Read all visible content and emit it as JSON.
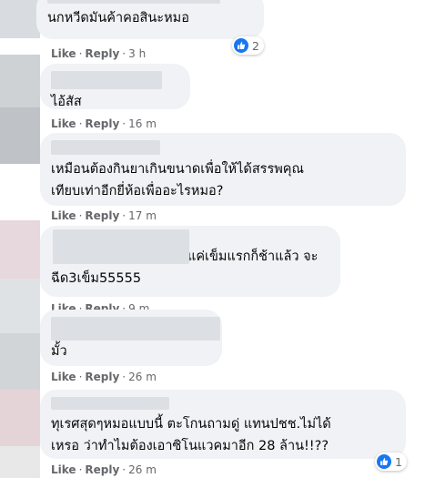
{
  "colors": {
    "bubble_bg": "#f0f2f5",
    "meta_text": "#65676b",
    "like_blue": "#1877f2"
  },
  "icons": {
    "like": "thumbs-up-icon"
  },
  "comments": [
    {
      "text_lines": [
        "นกหวีดมันค้าคอสินะหมอ"
      ],
      "actions": {
        "like": "Like",
        "reply": "Reply",
        "time": "3 h"
      },
      "reaction_count": "2"
    },
    {
      "text_lines": [
        "ไอ้สัส"
      ],
      "actions": {
        "like": "Like",
        "reply": "Reply",
        "time": "16 m"
      }
    },
    {
      "text_lines": [
        "เหมือนต้องกินยาเกินขนาดเพื่อให้ได้สรรพคุณ",
        "เทียบเท่าอีกยี่ห้อเพื่ออะไรหมอ?"
      ],
      "actions": {
        "like": "Like",
        "reply": "Reply",
        "time": "17 m"
      }
    },
    {
      "text_lines": [
        "แค่เข็มแรกก็ช้าแล้ว จะ",
        "ฉีด3เข็ม55555"
      ],
      "actions": {
        "like": "Like",
        "reply": "Reply",
        "time": "9 m"
      }
    },
    {
      "text_lines": [
        "มั้ว"
      ],
      "actions": {
        "like": "Like",
        "reply": "Reply",
        "time": "26 m"
      }
    },
    {
      "text_lines": [
        "ทุเรศสุดๆหมอแบบนี้ ตะโกนถามดู่ แทนปชช.ไม่ได้",
        "เหรอ ว่าทำไมต้องเอาซิโนแวคมาอีก 28 ล้าน!!??"
      ],
      "actions": {
        "like": "Like",
        "reply": "Reply",
        "time": "26 m"
      },
      "reaction_count": "1"
    }
  ]
}
